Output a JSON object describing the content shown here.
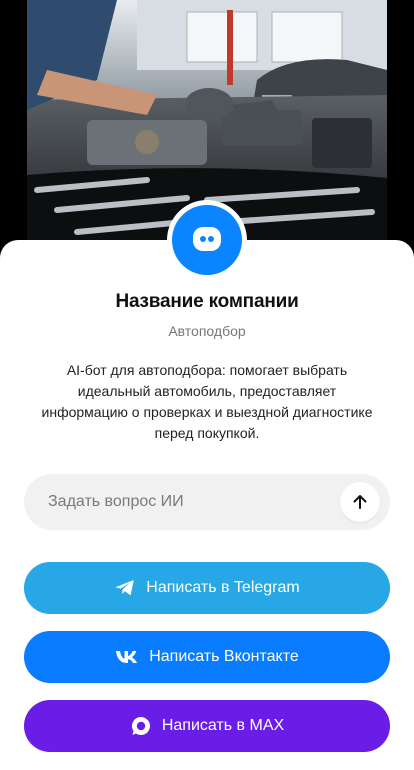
{
  "company": {
    "name": "Название компании",
    "category": "Автоподбор",
    "description": "AI-бот для автоподбора: помогает выбрать идеальный автомобиль, предоставляет информацию о проверках и выездной диагностике перед покупкой."
  },
  "ask": {
    "placeholder": "Задать вопрос ИИ",
    "value": ""
  },
  "buttons": {
    "telegram": "Написать в Telegram",
    "vk": "Написать Вконтакте",
    "max": "Написать в MAX"
  },
  "icons": {
    "avatar": "chat-bot-icon",
    "send": "arrow-up-icon",
    "telegram": "telegram-icon",
    "vk": "vk-icon",
    "max": "max-icon"
  },
  "colors": {
    "avatar": "#0a84ff",
    "telegram": "#27a7e5",
    "vk": "#0a7cff",
    "max": "#6a1de6"
  }
}
